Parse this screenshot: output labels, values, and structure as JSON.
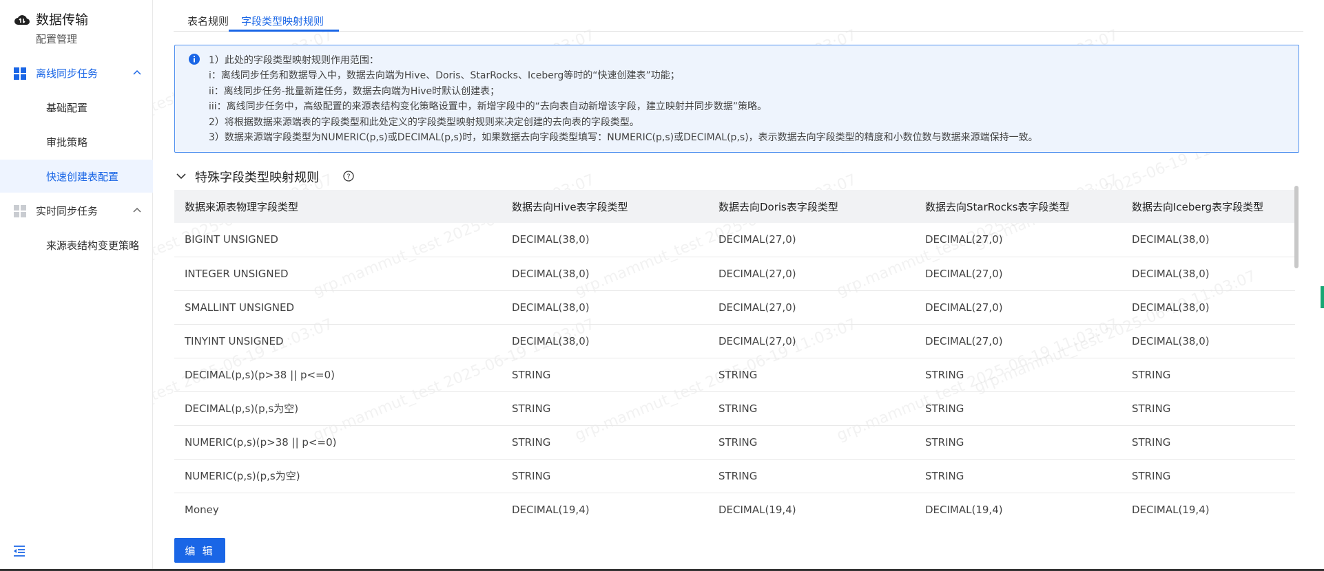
{
  "sidebar": {
    "brand_title": "数据传输",
    "brand_subtitle": "配置管理",
    "groups": [
      {
        "label": "离线同步任务",
        "active": true,
        "items": [
          "基础配置",
          "审批策略",
          "快速创建表配置"
        ]
      },
      {
        "label": "实时同步任务",
        "active": false,
        "items": [
          "来源表结构变更策略"
        ]
      }
    ],
    "active_item": "快速创建表配置"
  },
  "tabs": [
    {
      "label": "表名规则"
    },
    {
      "label": "字段类型映射规则"
    }
  ],
  "active_tab": "字段类型映射规则",
  "notice": {
    "lines": [
      "1）此处的字段类型映射规则作用范围：",
      "i：离线同步任务和数据导入中，数据去向端为Hive、Doris、StarRocks、Iceberg等时的“快速创建表”功能；",
      "ii：离线同步任务-批量新建任务，数据去向端为Hive时默认创建表；",
      "iii：离线同步任务中，高级配置的来源表结构变化策略设置中，新增字段中的“去向表自动新增该字段，建立映射并同步数据”策略。",
      "2）将根据数据来源端表的字段类型和此处定义的字段类型映射规则来决定创建的去向表的字段类型。",
      "3）数据来源端字段类型为NUMERIC(p,s)或DECIMAL(p,s)时，如果数据去向字段类型填写：NUMERIC(p,s)或DECIMAL(p,s)，表示数据去向字段类型的精度和小数位数与数据来源端保持一致。"
    ]
  },
  "section": {
    "title": "特殊字段类型映射规则"
  },
  "table": {
    "headers": [
      "数据来源表物理字段类型",
      "数据去向Hive表字段类型",
      "数据去向Doris表字段类型",
      "数据去向StarRocks表字段类型",
      "数据去向Iceberg表字段类型"
    ],
    "rows": [
      [
        "BIGINT UNSIGNED",
        "DECIMAL(38,0)",
        "DECIMAL(27,0)",
        "DECIMAL(27,0)",
        "DECIMAL(38,0)"
      ],
      [
        "INTEGER UNSIGNED",
        "DECIMAL(38,0)",
        "DECIMAL(27,0)",
        "DECIMAL(27,0)",
        "DECIMAL(38,0)"
      ],
      [
        "SMALLINT UNSIGNED",
        "DECIMAL(38,0)",
        "DECIMAL(27,0)",
        "DECIMAL(27,0)",
        "DECIMAL(38,0)"
      ],
      [
        "TINYINT UNSIGNED",
        "DECIMAL(38,0)",
        "DECIMAL(27,0)",
        "DECIMAL(27,0)",
        "DECIMAL(38,0)"
      ],
      [
        "DECIMAL(p,s)(p>38 || p<=0)",
        "STRING",
        "STRING",
        "STRING",
        "STRING"
      ],
      [
        "DECIMAL(p,s)(p,s为空)",
        "STRING",
        "STRING",
        "STRING",
        "STRING"
      ],
      [
        "NUMERIC(p,s)(p>38 || p<=0)",
        "STRING",
        "STRING",
        "STRING",
        "STRING"
      ],
      [
        "NUMERIC(p,s)(p,s为空)",
        "STRING",
        "STRING",
        "STRING",
        "STRING"
      ],
      [
        "Money",
        "DECIMAL(19,4)",
        "DECIMAL(19,4)",
        "DECIMAL(19,4)",
        "DECIMAL(19,4)"
      ],
      [
        "",
        "",
        "",
        "",
        ""
      ]
    ]
  },
  "edit_button": "编 辑",
  "watermark": "grp.mammut_test 2025-06-19 11:03:07",
  "colors": {
    "accent": "#1a66e6",
    "notice_bg": "#eef4fd",
    "notice_border": "#4d8fef",
    "header_bg": "#f1f2f4"
  },
  "icons": {
    "brand": "cloud-transfer-icon",
    "offline_group": "grid-icon",
    "realtime_group": "grid-icon",
    "group_toggle": "chevron-up-icon",
    "notice": "info-icon",
    "section_toggle": "chevron-down-icon",
    "section_help": "question-circle-icon",
    "collapse": "menu-collapse-icon"
  }
}
